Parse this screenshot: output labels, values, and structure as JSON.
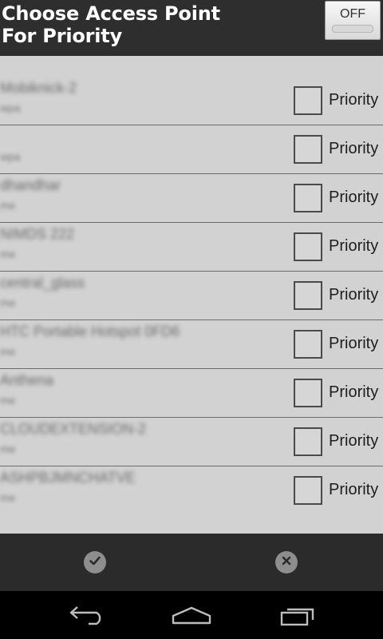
{
  "header": {
    "title": "Choose Access Point For Priority",
    "toggle_label": "OFF"
  },
  "access_points": [
    {
      "name": "Mobiknick-2",
      "security": "wpa",
      "priority_label": "Priority",
      "checked": false
    },
    {
      "name": "",
      "security": "wpa",
      "priority_label": "Priority",
      "checked": false
    },
    {
      "name": "dhandhar",
      "security": "me",
      "priority_label": "Priority",
      "checked": false
    },
    {
      "name": "NIMDS 222",
      "security": "me",
      "priority_label": "Priority",
      "checked": false
    },
    {
      "name": "central_glass",
      "security": "me",
      "priority_label": "Priority",
      "checked": false
    },
    {
      "name": "HTC Portable Hotspot 0FD6",
      "security": "me",
      "priority_label": "Priority",
      "checked": false
    },
    {
      "name": "Anthena",
      "security": "me",
      "priority_label": "Priority",
      "checked": false
    },
    {
      "name": "CLOUDEXTENSION-2",
      "security": "me",
      "priority_label": "Priority",
      "checked": false
    },
    {
      "name": "ASHPBJMNCHATVE",
      "security": "me",
      "priority_label": "Priority",
      "checked": false
    }
  ],
  "action_bar": {
    "confirm_icon": "checkmark-icon",
    "cancel_icon": "close-icon"
  },
  "nav_bar": {
    "back_icon": "back-icon",
    "home_icon": "home-icon",
    "recents_icon": "recents-icon"
  }
}
